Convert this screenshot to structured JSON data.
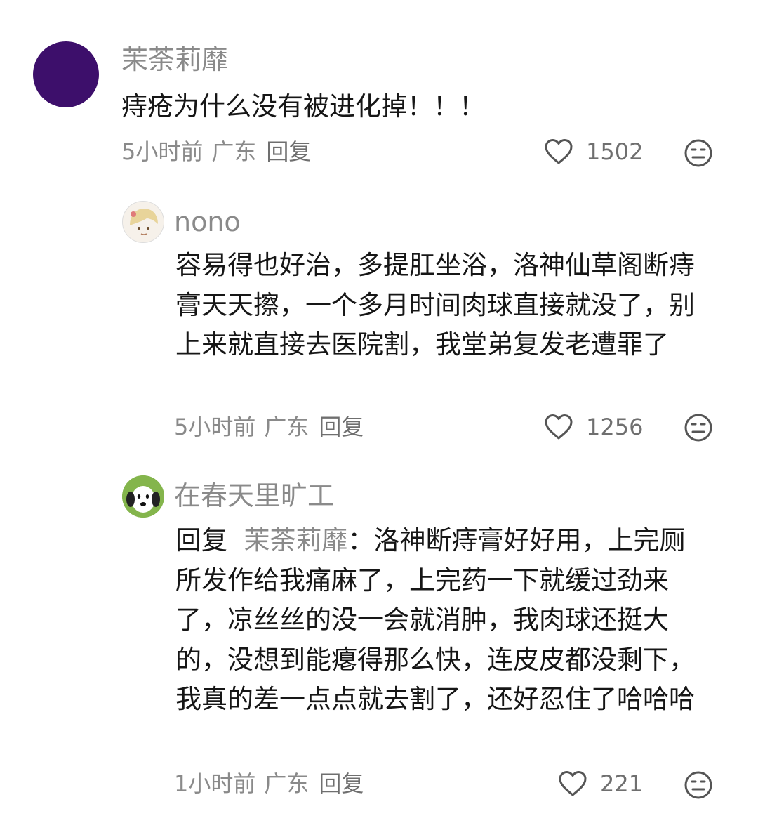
{
  "comments": [
    {
      "user": "茉荼莉靡",
      "text": "痔疮为什么没有被进化掉！！！",
      "time": "5小时前",
      "location": "广东",
      "reply_label": "回复",
      "likes": "1502",
      "avatar_color": "#3d0f6b"
    },
    {
      "user": "nono",
      "text": "容易得也好治，多提肛坐浴，洛神仙草阁断痔膏天天擦，一个多月时间肉球直接就没了，别上来就直接去医院割，我堂弟复发老遭罪了",
      "time": "5小时前",
      "location": "广东",
      "reply_label": "回复",
      "likes": "1256"
    },
    {
      "user": "在春天里旷工",
      "reply_prefix": "回复",
      "reply_target": "茉荼莉靡",
      "text": "：洛神断痔膏好好用，上完厕所发作给我痛麻了，上完药一下就缓过劲来了，凉丝丝的没一会就消肿，我肉球还挺大的，没想到能瘪得那么快，连皮皮都没剩下，我真的差一点点就去割了，还好忍住了哈哈哈",
      "time": "1小时前",
      "location": "广东",
      "reply_label": "回复",
      "likes": "221"
    }
  ],
  "icons": {
    "like": "heart-outline-icon",
    "dislike": "neutral-face-icon"
  }
}
